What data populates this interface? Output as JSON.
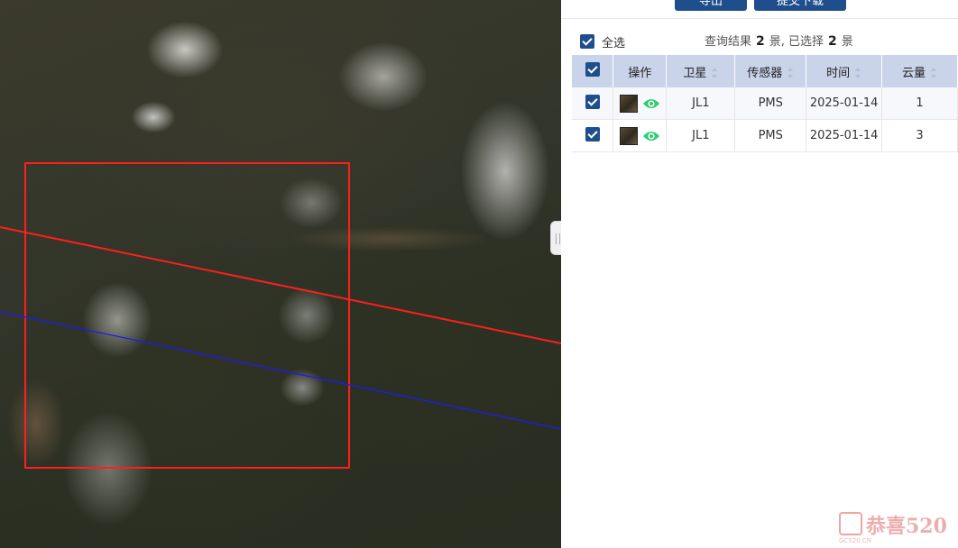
{
  "map": {
    "footprint_color": "#ff1e1e",
    "line1_color": "#ff1e1e",
    "line2_color": "#1a1aff"
  },
  "toolbar": {
    "button1_label": "导出",
    "button2_label": "提交下载"
  },
  "selection": {
    "select_all_label": "全选",
    "summary_prefix": "查询结果",
    "result_count": "2",
    "summary_middle": "景, 已选择",
    "selected_count": "2",
    "summary_suffix": "景"
  },
  "table": {
    "headers": {
      "operation": "操作",
      "satellite": "卫星",
      "sensor": "传感器",
      "time": "时间",
      "cloud": "云量"
    },
    "rows": [
      {
        "satellite": "JL1",
        "sensor": "PMS",
        "time": "2025-01-14",
        "cloud": "1"
      },
      {
        "satellite": "JL1",
        "sensor": "PMS",
        "time": "2025-01-14",
        "cloud": "3"
      }
    ]
  },
  "accent_color": "#1f4e8c",
  "eye_icon_color": "#2ecc71",
  "watermark": {
    "text": "恭喜520",
    "sub": "GC520.CN"
  }
}
